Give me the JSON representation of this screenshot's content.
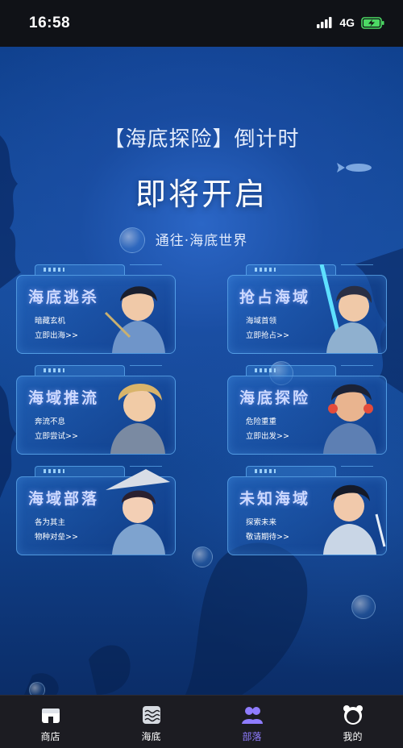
{
  "status_bar": {
    "time": "16:58",
    "network": "4G"
  },
  "hero": {
    "title": "【海底探险】倒计时",
    "headline": "即将开启",
    "subtitle": "通往·海底世界"
  },
  "cards": [
    {
      "title": "海底逃杀",
      "desc": "暗藏玄机",
      "link": "立即出海>>"
    },
    {
      "title": "抢占海域",
      "desc": "海域首领",
      "link": "立即抢占>>"
    },
    {
      "title": "海域推流",
      "desc": "奔流不息",
      "link": "立即尝试>>"
    },
    {
      "title": "海底探险",
      "desc": "危险重重",
      "link": "立即出发>>"
    },
    {
      "title": "海域部落",
      "desc": "各为其主",
      "link": "物种对垒>>"
    },
    {
      "title": "未知海域",
      "desc": "探索未来",
      "link": "敬请期待>>"
    }
  ],
  "tabbar": [
    {
      "label": "商店",
      "icon": "shop-icon"
    },
    {
      "label": "海底",
      "icon": "waves-icon"
    },
    {
      "label": "部落",
      "icon": "group-icon",
      "active": true
    },
    {
      "label": "我的",
      "icon": "panda-icon"
    }
  ],
  "colors": {
    "accent": "#8f7cff",
    "background": "#174f9f",
    "card_border": "#6ebeff"
  }
}
